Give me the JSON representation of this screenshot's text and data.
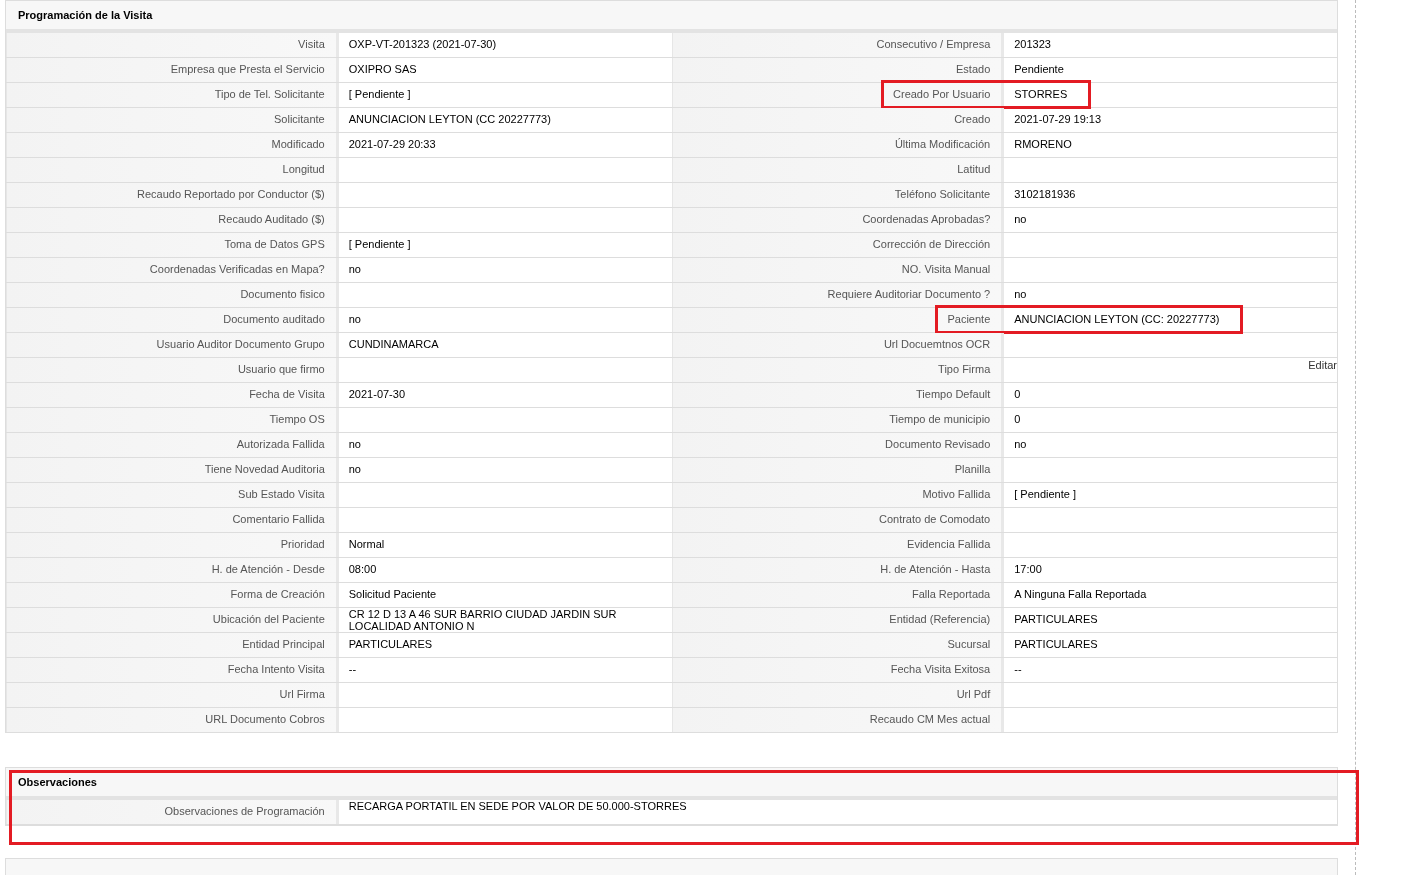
{
  "sections": [
    {
      "title": "Programación de la Visita",
      "highlighted": false,
      "rows": [
        {
          "left": {
            "label": "Visita",
            "value": "OXP-VT-201323 (2021-07-30)",
            "highlighted": false
          },
          "right": {
            "label": "Consecutivo / Empresa",
            "value": "201323",
            "highlighted": false
          }
        },
        {
          "left": {
            "label": "Empresa que Presta el Servicio",
            "value": "OXIPRO SAS",
            "highlighted": false
          },
          "right": {
            "label": "Estado",
            "value": "Pendiente",
            "highlighted": false
          }
        },
        {
          "left": {
            "label": "Tipo de Tel. Solicitante",
            "value": "[ Pendiente ]",
            "highlighted": false
          },
          "right": {
            "label": "Creado Por Usuario",
            "value": "STORRES",
            "highlighted": true
          }
        },
        {
          "left": {
            "label": "Solicitante",
            "value": "ANUNCIACION LEYTON (CC 20227773)",
            "highlighted": false
          },
          "right": {
            "label": "Creado",
            "value": "2021-07-29 19:13",
            "highlighted": false
          }
        },
        {
          "left": {
            "label": "Modificado",
            "value": "2021-07-29 20:33",
            "highlighted": false
          },
          "right": {
            "label": "Última Modificación",
            "value": "RMORENO",
            "highlighted": false
          }
        },
        {
          "left": {
            "label": "Longitud",
            "highlighted": false
          },
          "right": {
            "label": "Latitud",
            "highlighted": false
          }
        },
        {
          "left": {
            "label": "Recaudo Reportado por Conductor ($)",
            "highlighted": false
          },
          "right": {
            "label": "Teléfono Solicitante",
            "value": "3102181936",
            "highlighted": false
          }
        },
        {
          "left": {
            "label": "Recaudo Auditado ($)",
            "highlighted": false
          },
          "right": {
            "label": "Coordenadas Aprobadas?",
            "value": "no",
            "highlighted": false
          }
        },
        {
          "left": {
            "label": "Toma de Datos GPS",
            "value": "[ Pendiente ]",
            "highlighted": false
          },
          "right": {
            "label": "Corrección de Dirección",
            "highlighted": false
          }
        },
        {
          "left": {
            "label": "Coordenadas Verificadas en Mapa?",
            "value": "no",
            "highlighted": false
          },
          "right": {
            "label": "NO. Visita Manual",
            "highlighted": false
          }
        },
        {
          "left": {
            "label": "Documento fisico",
            "highlighted": false
          },
          "right": {
            "label": "Requiere Auditoriar Documento ?",
            "value": "no",
            "highlighted": false
          }
        },
        {
          "left": {
            "label": "Documento auditado",
            "value": "no",
            "highlighted": false
          },
          "right": {
            "label": "Paciente",
            "value": "ANUNCIACION LEYTON (CC: 20227773)",
            "highlighted": true
          }
        },
        {
          "left": {
            "label": "Usuario Auditor Documento Grupo",
            "value": "CUNDINAMARCA",
            "highlighted": false
          },
          "right": {
            "label": "Url Docuemtnos OCR",
            "highlighted": false
          }
        },
        {
          "left": {
            "label": "Usuario que firmo",
            "highlighted": false
          },
          "right": {
            "label": "Tipo Firma",
            "action": "Editar",
            "highlighted": false
          }
        },
        {
          "left": {
            "label": "Fecha de Visita",
            "value": "2021-07-30",
            "highlighted": false
          },
          "right": {
            "label": "Tiempo Default",
            "value": "0",
            "highlighted": false
          }
        },
        {
          "left": {
            "label": "Tiempo OS",
            "highlighted": false
          },
          "right": {
            "label": "Tiempo de municipio",
            "value": "0",
            "highlighted": false
          }
        },
        {
          "left": {
            "label": "Autorizada Fallida",
            "value": "no",
            "highlighted": false
          },
          "right": {
            "label": "Documento Revisado",
            "value": "no",
            "highlighted": false
          }
        },
        {
          "left": {
            "label": "Tiene Novedad Auditoria",
            "value": "no",
            "highlighted": false
          },
          "right": {
            "label": "Planilla",
            "highlighted": false
          }
        },
        {
          "left": {
            "label": "Sub Estado Visita",
            "highlighted": false
          },
          "right": {
            "label": "Motivo Fallida",
            "value": "[ Pendiente ]",
            "highlighted": false
          }
        },
        {
          "left": {
            "label": "Comentario Fallida",
            "highlighted": false
          },
          "right": {
            "label": "Contrato de Comodato",
            "highlighted": false
          }
        },
        {
          "left": {
            "label": "Prioridad",
            "value": "Normal",
            "highlighted": false
          },
          "right": {
            "label": "Evidencia Fallida",
            "highlighted": false
          }
        },
        {
          "left": {
            "label": "H. de Atención - Desde",
            "value": "08:00",
            "highlighted": false
          },
          "right": {
            "label": "H. de Atención - Hasta",
            "value": "17:00",
            "highlighted": false
          }
        },
        {
          "left": {
            "label": "Forma de Creación",
            "value": "Solicitud Paciente",
            "highlighted": false
          },
          "right": {
            "label": "Falla Reportada",
            "value": "A Ninguna Falla Reportada",
            "highlighted": false
          }
        },
        {
          "left": {
            "label": "Ubicación del Paciente",
            "value": "CR 12 D 13 A 46 SUR BARRIO CIUDAD JARDIN SUR LOCALIDAD ANTONIO N",
            "highlighted": false
          },
          "right": {
            "label": "Entidad (Referencia)",
            "value": "PARTICULARES",
            "highlighted": false
          }
        },
        {
          "left": {
            "label": "Entidad Principal",
            "value": "PARTICULARES",
            "highlighted": false
          },
          "right": {
            "label": "Sucursal",
            "value": "PARTICULARES",
            "highlighted": false
          }
        },
        {
          "left": {
            "label": "Fecha Intento Visita",
            "value": "--",
            "highlighted": false
          },
          "right": {
            "label": "Fecha Visita Exitosa",
            "value": "--",
            "highlighted": false
          }
        },
        {
          "left": {
            "label": "Url Firma",
            "highlighted": false
          },
          "right": {
            "label": "Url Pdf",
            "highlighted": false
          }
        },
        {
          "left": {
            "label": "URL Documento Cobros",
            "highlighted": false
          },
          "right": {
            "label": "Recaudo CM Mes actual",
            "highlighted": false
          }
        }
      ]
    },
    {
      "title": "Observaciones",
      "highlighted": true,
      "rows": [
        {
          "left": {
            "label": "Observaciones de Programación",
            "value": "RECARGA PORTATIL EN SEDE POR VALOR DE 50.000-STORRES",
            "highlighted": false
          }
        }
      ]
    }
  ]
}
